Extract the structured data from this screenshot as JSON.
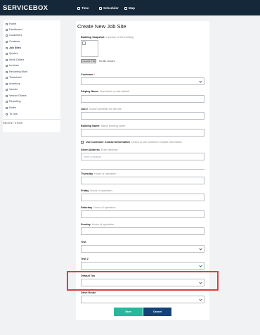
{
  "brand": {
    "logo": "SERVICEBOX"
  },
  "topnav": [
    {
      "label": "Time",
      "icon": "clock-icon"
    },
    {
      "label": "Scheduler",
      "icon": "calendar-icon"
    },
    {
      "label": "Map",
      "icon": "map-icon"
    }
  ],
  "sidebar": {
    "items": [
      {
        "label": "Home",
        "icon": "home-icon"
      },
      {
        "label": "Dashboard",
        "icon": "dashboard-icon"
      },
      {
        "label": "Customers",
        "icon": "customers-icon"
      },
      {
        "label": "Contacts",
        "icon": "contacts-icon"
      },
      {
        "label": "Job Sites",
        "icon": "job-sites-icon",
        "active": true
      },
      {
        "label": "Quotes",
        "icon": "quotes-icon"
      },
      {
        "label": "Work Orders",
        "icon": "work-orders-icon"
      },
      {
        "label": "Invoices",
        "icon": "invoices-icon"
      },
      {
        "label": "Recurring Work",
        "icon": "recurring-icon"
      },
      {
        "label": "Timesheet",
        "icon": "timesheet-icon"
      },
      {
        "label": "Inventory",
        "icon": "inventory-icon"
      },
      {
        "label": "Vendor",
        "icon": "vendor-icon"
      },
      {
        "label": "Vendor Orders",
        "icon": "vendor-orders-icon"
      },
      {
        "label": "Reporting",
        "icon": "reporting-icon"
      },
      {
        "label": "Notes",
        "icon": "notes-icon"
      },
      {
        "label": "To Dos",
        "icon": "todos-icon"
      }
    ],
    "section_label": "RECENT ITEMS"
  },
  "form": {
    "title": "Create New Job Site",
    "building_snapshot": {
      "label": "Building Snapshot",
      "hint": "A picture of the building"
    },
    "choose_file": "Choose File",
    "no_file": "No file chosen",
    "customer": {
      "label": "Customer",
      "required": "*"
    },
    "display_name": {
      "label": "Display Name",
      "hint": "How listed on site default"
    },
    "job_no": {
      "label": "Job #",
      "hint": "A short identifier for the site"
    },
    "building_name": {
      "label": "Building Name",
      "hint": "Name building name"
    },
    "use_customer_contact": {
      "label": "Use Customer Contact Information",
      "hint": "Check to use customer contact Information"
    },
    "street_address": {
      "label": "Street Address",
      "hint": "Enter address",
      "placeholder": "Enter a location"
    },
    "thursday": {
      "label": "Thursday",
      "hint": "Hours of operation"
    },
    "friday": {
      "label": "Friday",
      "hint": "Hours of operation"
    },
    "saturday": {
      "label": "Saturday",
      "hint": "Hours of operation"
    },
    "sunday": {
      "label": "Sunday",
      "hint": "Hours of operation"
    },
    "test": {
      "label": "Test"
    },
    "test2": {
      "label": "Test 2"
    },
    "default_tax": {
      "label": "Default Tax"
    },
    "drive_route": {
      "label": "Drive Route"
    },
    "save": "Save",
    "cancel": "Cancel"
  }
}
